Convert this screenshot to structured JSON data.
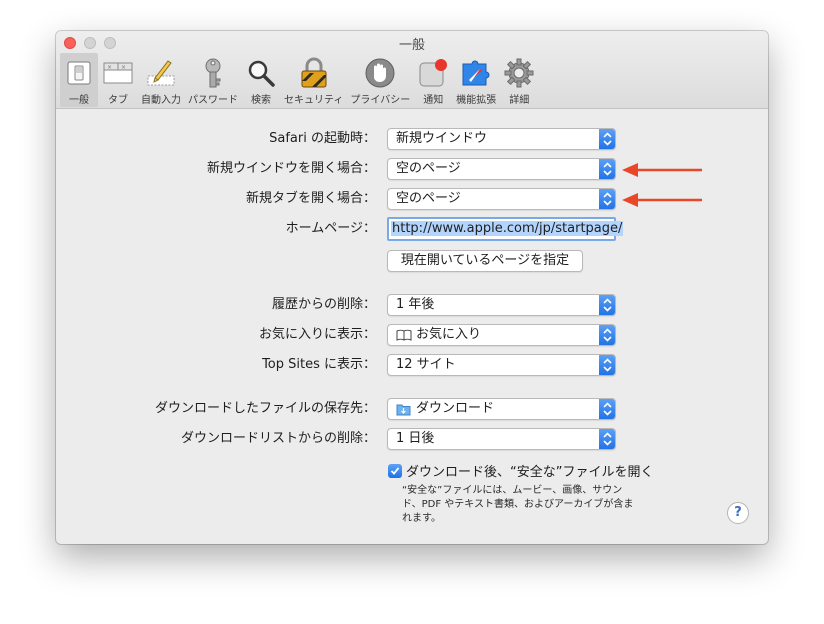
{
  "window": {
    "title": "一般"
  },
  "toolbar": {
    "items": [
      {
        "label": "一般",
        "icon": "general-switch-icon",
        "selected": true
      },
      {
        "label": "タブ",
        "icon": "tabs-icon"
      },
      {
        "label": "自動入力",
        "icon": "pencil-icon"
      },
      {
        "label": "パスワード",
        "icon": "key-icon"
      },
      {
        "label": "検索",
        "icon": "magnifier-icon"
      },
      {
        "label": "セキュリティ",
        "icon": "padlock-icon"
      },
      {
        "label": "プライバシー",
        "icon": "hand-icon"
      },
      {
        "label": "通知",
        "icon": "notification-icon"
      },
      {
        "label": "機能拡張",
        "icon": "puzzle-icon"
      },
      {
        "label": "詳細",
        "icon": "gear-icon"
      }
    ]
  },
  "settings": {
    "launch": {
      "label": "Safari の起動時：",
      "value": "新規ウインドウ"
    },
    "new_window": {
      "label": "新規ウインドウを開く場合：",
      "value": "空のページ"
    },
    "new_tab": {
      "label": "新規タブを開く場合：",
      "value": "空のページ"
    },
    "homepage": {
      "label": "ホームページ：",
      "value": "http://www.apple.com/jp/startpage/"
    },
    "set_current_button": "現在開いているページを指定",
    "history": {
      "label": "履歴からの削除：",
      "value": "1 年後"
    },
    "favorites": {
      "label": "お気に入りに表示：",
      "value": "お気に入り"
    },
    "topsites": {
      "label": "Top Sites に表示：",
      "value": "12 サイト"
    },
    "download_location": {
      "label": "ダウンロードしたファイルの保存先：",
      "value": "ダウンロード"
    },
    "download_remove": {
      "label": "ダウンロードリストからの削除：",
      "value": "1 日後"
    },
    "safe_files": {
      "label": "ダウンロード後、“安全な”ファイルを開く",
      "checked": true,
      "description_lines": [
        "“安全な”ファイルには、ムービー、画像、サウン",
        "ド、PDF やテキスト書類、およびアーカイブが含ま",
        "れます。"
      ]
    },
    "help": "?"
  },
  "colors": {
    "accent": "#1e71e6",
    "annotation_arrow": "#e8472a",
    "close": "#fc605b"
  }
}
